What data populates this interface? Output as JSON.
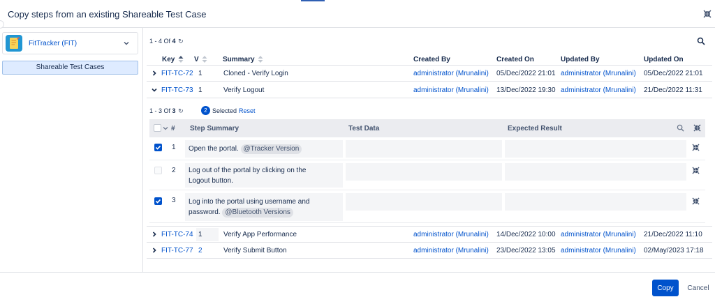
{
  "dialog": {
    "title": "Copy steps from an existing Shareable Test Case"
  },
  "sidebar": {
    "project": {
      "name": "FitTracker (FIT)",
      "icon": "notebook-icon"
    },
    "items": [
      {
        "label": "Shareable Test Cases"
      }
    ]
  },
  "test_cases": {
    "pager": {
      "range": "1 - 4 Of",
      "total": "4"
    },
    "columns": {
      "key": "Key",
      "version": "V",
      "summary": "Summary",
      "created_by": "Created By",
      "created_on": "Created On",
      "updated_by": "Updated By",
      "updated_on": "Updated On"
    },
    "rows": [
      {
        "key": "FIT-TC-72",
        "version": "1",
        "summary": "Cloned - Verify Login",
        "created_by": "administrator (Mrunalini)",
        "created_on": "05/Dec/2022 21:01",
        "updated_by": "administrator (Mrunalini)",
        "updated_on": "05/Dec/2022 21:01"
      },
      {
        "key": "FIT-TC-73",
        "version": "1",
        "summary": "Verify Logout",
        "created_by": "administrator (Mrunalini)",
        "created_on": "13/Dec/2022 19:30",
        "updated_by": "administrator (Mrunalini)",
        "updated_on": "21/Dec/2022 11:31"
      },
      {
        "key": "FIT-TC-74",
        "version": "1",
        "summary": "Verify App Performance",
        "created_by": "administrator (Mrunalini)",
        "created_on": "14/Dec/2022 10:00",
        "updated_by": "administrator (Mrunalini)",
        "updated_on": "21/Dec/2022 11:10"
      },
      {
        "key": "FIT-TC-77",
        "version": "2",
        "summary": "Verify Submit Button",
        "created_by": "administrator (Mrunalini)",
        "created_on": "23/Dec/2022 13:05",
        "updated_by": "administrator (Mrunalini)",
        "updated_on": "02/May/2023 17:18"
      }
    ]
  },
  "steps": {
    "pager": {
      "range": "1 - 3 Of",
      "total": "3"
    },
    "selected_count": "2",
    "selected_label": "Selected",
    "reset_label": "Reset",
    "columns": {
      "num": "#",
      "summary": "Step Summary",
      "test_data": "Test Data",
      "expected": "Expected Result"
    },
    "rows": [
      {
        "num": "1",
        "checked": true,
        "text": "Open the portal.",
        "tag": "@Tracker Version"
      },
      {
        "num": "2",
        "checked": false,
        "line1": "Log out of the portal by clicking on the",
        "line2": "Logout button."
      },
      {
        "num": "3",
        "checked": true,
        "line1": "Log into the portal using username and",
        "line2": "password.",
        "tag": "@Bluetooth Versions"
      }
    ]
  },
  "footer": {
    "copy_label": "Copy",
    "cancel_label": "Cancel"
  },
  "colors": {
    "accent": "#0052cc",
    "selection": "#deebff",
    "header_bg": "#ebecf0"
  }
}
